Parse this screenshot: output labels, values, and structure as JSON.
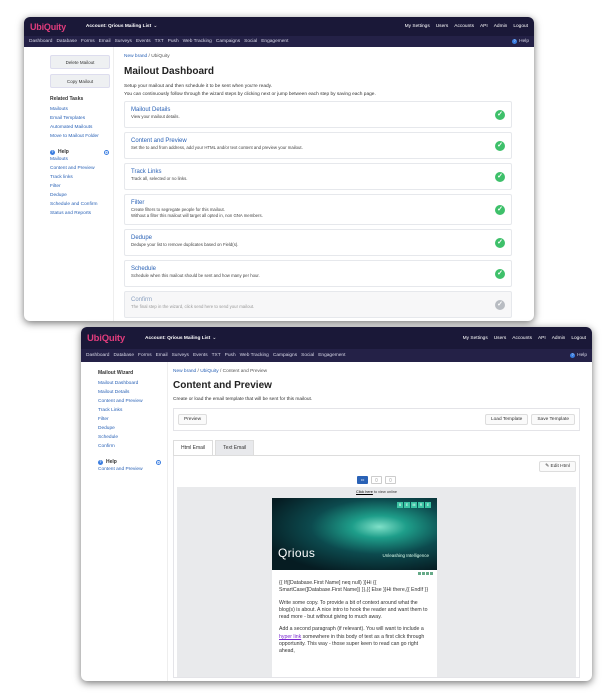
{
  "window1": {
    "logo": "UbiQuity",
    "account": "Account: Qrious Mailing List",
    "top_links": [
      "My Settings",
      "Users",
      "Accounts",
      "API",
      "Admin",
      "Logout"
    ],
    "nav": [
      "Dashboard",
      "Database",
      "Forms",
      "Email",
      "Surveys",
      "Events",
      "TXT",
      "Push",
      "Web Tracking",
      "Campaigns",
      "Social",
      "Engagement"
    ],
    "help": "Help",
    "buttons": {
      "delete": "Delete Mailout",
      "copy": "Copy Mailout"
    },
    "related_tasks_heading": "Related Tasks",
    "related_tasks": [
      "Mailouts",
      "Email Templates",
      "Automated Mailouts",
      "Move to Mailout Folder"
    ],
    "help_heading": "Help",
    "help_links": [
      "Mailouts",
      "Content and Preview",
      "Track links",
      "Filter",
      "Dedupe",
      "Schedule and Confirm",
      "Status and Reports"
    ],
    "breadcrumb": {
      "link": "New brand",
      "sep": " / ",
      "current": "UbiQuity"
    },
    "title": "Mailout Dashboard",
    "intro1": "Setup your mailout and then schedule it to be sent when you're ready.",
    "intro2": "You can continuously follow through the wizard steps by clicking next or jump between each step by saving each page.",
    "steps": [
      {
        "title": "Mailout Details",
        "desc": "View your mailout details.",
        "desc2": "",
        "done": true
      },
      {
        "title": "Content and Preview",
        "desc": "Set the to and from address, add your HTML and/or text content and preview your mailout.",
        "desc2": "",
        "done": true
      },
      {
        "title": "Track Links",
        "desc": "Track all, selected or no links.",
        "desc2": "",
        "done": true
      },
      {
        "title": "Filter",
        "desc": "Create filters to segregate people for this mailout.",
        "desc2": "Without a filter this mailout will target all opted in, non GNA members.",
        "done": true
      },
      {
        "title": "Dedupe",
        "desc": "Dedupe your list to remove duplicates based on Field(s).",
        "desc2": "",
        "done": true
      },
      {
        "title": "Schedule",
        "desc": "Schedule when this mailout should be sent and how many per hour.",
        "desc2": "",
        "done": true
      },
      {
        "title": "Confirm",
        "desc": "The final step in the wizard, click send here to send your mailout.",
        "desc2": "",
        "done": false
      }
    ]
  },
  "window2": {
    "logo": "UbiQuity",
    "account": "Account: Qrious Mailing List",
    "top_links": [
      "My Settings",
      "Users",
      "Accounts",
      "API",
      "Admin",
      "Logout"
    ],
    "nav": [
      "Dashboard",
      "Database",
      "Forms",
      "Email",
      "Surveys",
      "Events",
      "TXT",
      "Push",
      "Web Tracking",
      "Campaigns",
      "Social",
      "Engagement"
    ],
    "help": "Help",
    "wizard_heading": "Mailout Wizard",
    "wizard_links": [
      "Mailout Dashboard",
      "Mailout Details",
      "Content and Preview",
      "Track Links",
      "Filter",
      "Dedupe",
      "Schedule",
      "Confirm"
    ],
    "help_heading": "Help",
    "help_links": [
      "Content and Preview"
    ],
    "breadcrumb": {
      "link1": "New brand",
      "sep": " / ",
      "link2": "UbiQuity",
      "current": "Content and Preview"
    },
    "title": "Content and Preview",
    "subtitle": "Create or load the email template that will be sent for this mailout.",
    "preview_btn": "Preview",
    "load_template": "Load Template",
    "save_template": "Save Template",
    "tabs": [
      "Html Email",
      "Text Email"
    ],
    "edit_html": "Edit Html",
    "online_prefix": "Click here",
    "online_suffix": " to view online",
    "hero_brand": "Qrious",
    "hero_tag": "Unleashing Intelligence",
    "hero_blocks": [
      "B",
      "E",
      "M",
      "R",
      "E"
    ],
    "email_p1": "{{ If([Database.First Name] neq null) }}Hi {{ SmartCase([Database.First Name]) }},{{ Else }}Hi there,{{ EndIf }}",
    "email_p2": "Write some copy. To provide a bit of context around what the blog(s) is about. A nice intro to hook the reader and want them to read more - but without giving to much away.",
    "email_p3_a": "Add a second paragraph (if relevant). You will want to include a ",
    "email_p3_link": "hyper link",
    "email_p3_b": " somewhere in this body of text as a first click through opportunity. This way - those super keen to read can go right ahead,"
  },
  "colors": {
    "topbar": "#1a1838",
    "navbar": "#242147",
    "logo": "#e03c7c",
    "link": "#2a62b6",
    "check": "#3ec06a"
  }
}
